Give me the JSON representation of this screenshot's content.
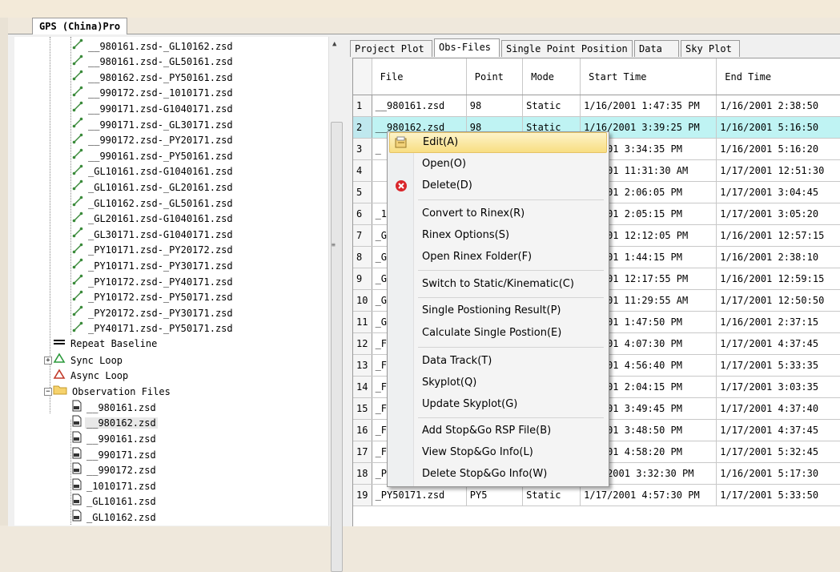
{
  "window": {
    "doc_tab": "GPS (China)Pro"
  },
  "tree": {
    "baselines": [
      "__980161.zsd-_GL10162.zsd",
      "__980161.zsd-_GL50161.zsd",
      "__980162.zsd-_PY50161.zsd",
      "__990172.zsd-_1010171.zsd",
      "__990171.zsd-G1040171.zsd",
      "__990171.zsd-_GL30171.zsd",
      "__990172.zsd-_PY20171.zsd",
      "__990161.zsd-_PY50161.zsd",
      "_GL10161.zsd-G1040161.zsd",
      "_GL10161.zsd-_GL20161.zsd",
      "_GL10162.zsd-_GL50161.zsd",
      "_GL20161.zsd-G1040161.zsd",
      "_GL30171.zsd-G1040171.zsd",
      "_PY10171.zsd-_PY20172.zsd",
      "_PY10171.zsd-_PY30171.zsd",
      "_PY10172.zsd-_PY40171.zsd",
      "_PY10172.zsd-_PY50171.zsd",
      "_PY20172.zsd-_PY30171.zsd",
      "_PY40171.zsd-_PY50171.zsd"
    ],
    "repeat_baseline": "Repeat Baseline",
    "sync_loop": "Sync Loop",
    "async_loop": "Async Loop",
    "observation_files": "Observation Files",
    "files": [
      "__980161.zsd",
      "__980162.zsd",
      "__990161.zsd",
      "__990171.zsd",
      "__990172.zsd",
      "_1010171.zsd",
      "_GL10161.zsd",
      "_GL10162.zsd"
    ],
    "selected_file": "__980162.zsd"
  },
  "tabs": [
    "Project Plot",
    "Obs-Files",
    "Single Point Position",
    "Data",
    "Sky Plot"
  ],
  "grid": {
    "columns": [
      "File",
      "Point",
      "Mode",
      "Start Time",
      "End Time"
    ],
    "rows": [
      {
        "n": "1",
        "file": "__980161.zsd",
        "point": "98",
        "mode": "Static",
        "start": "1/16/2001 1:47:35 PM",
        "end": "1/16/2001 2:38:50"
      },
      {
        "n": "2",
        "file": "__980162.zsd",
        "point": "98",
        "mode": "Static",
        "start": "1/16/2001 3:39:25 PM",
        "end": "1/16/2001 5:16:50"
      },
      {
        "n": "3",
        "file": "_",
        "point": "",
        "mode": "",
        "start": "6/2001 3:34:35 PM",
        "end": "1/16/2001 5:16:20"
      },
      {
        "n": "4",
        "file": "",
        "point": "",
        "mode": "",
        "start": "7/2001 11:31:30 AM",
        "end": "1/17/2001 12:51:30"
      },
      {
        "n": "5",
        "file": "",
        "point": "",
        "mode": "",
        "start": "7/2001 2:06:05 PM",
        "end": "1/17/2001 3:04:45"
      },
      {
        "n": "6",
        "file": "_1",
        "point": "",
        "mode": "",
        "start": "7/2001 2:05:15 PM",
        "end": "1/17/2001 3:05:20"
      },
      {
        "n": "7",
        "file": "_G",
        "point": "",
        "mode": "",
        "start": "6/2001 12:12:05 PM",
        "end": "1/16/2001 12:57:15"
      },
      {
        "n": "8",
        "file": "_G",
        "point": "",
        "mode": "",
        "start": "6/2001 1:44:15 PM",
        "end": "1/16/2001 2:38:10"
      },
      {
        "n": "9",
        "file": "_G",
        "point": "",
        "mode": "",
        "start": "6/2001 12:17:55 PM",
        "end": "1/16/2001 12:59:15"
      },
      {
        "n": "10",
        "file": "_G",
        "point": "",
        "mode": "",
        "start": "7/2001 11:29:55 AM",
        "end": "1/17/2001 12:50:50"
      },
      {
        "n": "11",
        "file": "_G",
        "point": "",
        "mode": "",
        "start": "6/2001 1:47:50 PM",
        "end": "1/16/2001 2:37:15"
      },
      {
        "n": "12",
        "file": "_F",
        "point": "",
        "mode": "",
        "start": "7/2001 4:07:30 PM",
        "end": "1/17/2001 4:37:45"
      },
      {
        "n": "13",
        "file": "_F",
        "point": "",
        "mode": "",
        "start": "7/2001 4:56:40 PM",
        "end": "1/17/2001 5:33:35"
      },
      {
        "n": "14",
        "file": "_F",
        "point": "",
        "mode": "",
        "start": "7/2001 2:04:15 PM",
        "end": "1/17/2001 3:03:35"
      },
      {
        "n": "15",
        "file": "_F",
        "point": "",
        "mode": "",
        "start": "7/2001 3:49:45 PM",
        "end": "1/17/2001 4:37:40"
      },
      {
        "n": "16",
        "file": "_F",
        "point": "",
        "mode": "",
        "start": "7/2001 3:48:50 PM",
        "end": "1/17/2001 4:37:45"
      },
      {
        "n": "17",
        "file": "_F",
        "point": "",
        "mode": "",
        "start": "7/2001 4:58:20 PM",
        "end": "1/17/2001 5:32:45"
      },
      {
        "n": "18",
        "file": "_P",
        "point": "",
        "mode": "",
        "start": "/16/2001 3:32:30 PM",
        "end": "1/16/2001 5:17:30"
      },
      {
        "n": "19",
        "file": "_PY50171.zsd",
        "point": "PY5",
        "mode": "Static",
        "start": "1/17/2001 4:57:30 PM",
        "end": "1/17/2001 5:33:50"
      }
    ]
  },
  "context_menu": {
    "edit": "Edit(A)",
    "open": "Open(O)",
    "delete": "Delete(D)",
    "convert_rinex": "Convert to Rinex(R)",
    "rinex_options": "Rinex Options(S)",
    "open_rinex_folder": "Open Rinex Folder(F)",
    "switch_mode": "Switch to Static/Kinematic(C)",
    "single_result": "Single Postioning Result(P)",
    "calc_single": "Calculate Single Postion(E)",
    "data_track": "Data Track(T)",
    "skyplot": "Skyplot(Q)",
    "update_skyplot": "Update Skyplot(G)",
    "add_stopgo": "Add Stop&Go RSP File(B)",
    "view_stopgo": "View Stop&Go Info(L)",
    "delete_stopgo": "Delete Stop&Go Info(W)"
  },
  "colors": {
    "highlight_row": "#bff3f3",
    "menu_hover": "#f8de82"
  }
}
